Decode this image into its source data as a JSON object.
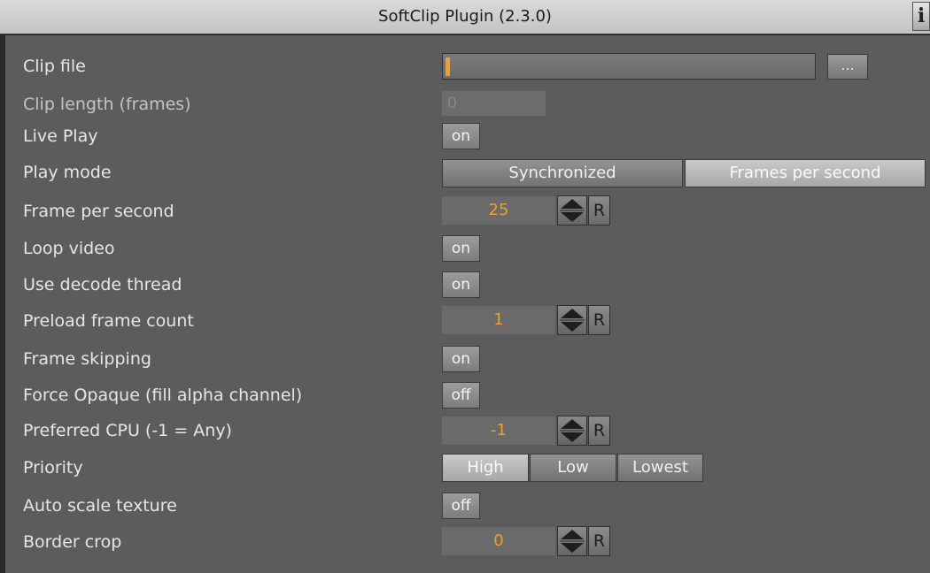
{
  "window": {
    "title": "SoftClip Plugin (2.3.0)",
    "info_label": "i"
  },
  "labels": {
    "clip_file": "Clip file",
    "clip_length": "Clip length (frames)",
    "live_play": "Live Play",
    "play_mode": "Play mode",
    "fps": "Frame per second",
    "loop_video": "Loop video",
    "decode_thread": "Use decode thread",
    "preload": "Preload frame count",
    "frame_skipping": "Frame skipping",
    "force_opaque": "Force Opaque (fill alpha channel)",
    "preferred_cpu": "Preferred CPU (-1 = Any)",
    "priority": "Priority",
    "auto_scale": "Auto scale texture",
    "border_crop": "Border crop"
  },
  "values": {
    "clip_file": "",
    "browse_label": "...",
    "clip_length": "0",
    "live_play": "on",
    "fps": "25",
    "loop_video": "on",
    "decode_thread": "on",
    "preload": "1",
    "frame_skipping": "on",
    "force_opaque": "off",
    "preferred_cpu": "-1",
    "auto_scale": "off",
    "border_crop": "0",
    "reset_label": "R"
  },
  "play_mode": {
    "options": [
      "Synchronized",
      "Frames per second"
    ],
    "selected": "Frames per second"
  },
  "priority": {
    "options": [
      "High",
      "Low",
      "Lowest"
    ],
    "selected": "High"
  },
  "colors": {
    "panel_bg": "#5c5c5c",
    "accent_value": "#f0a020",
    "title_bar": "#d0d0d0"
  },
  "icons": {
    "spinner": "up-down-arrows-icon",
    "info": "info-icon",
    "browse": "ellipsis-icon"
  }
}
